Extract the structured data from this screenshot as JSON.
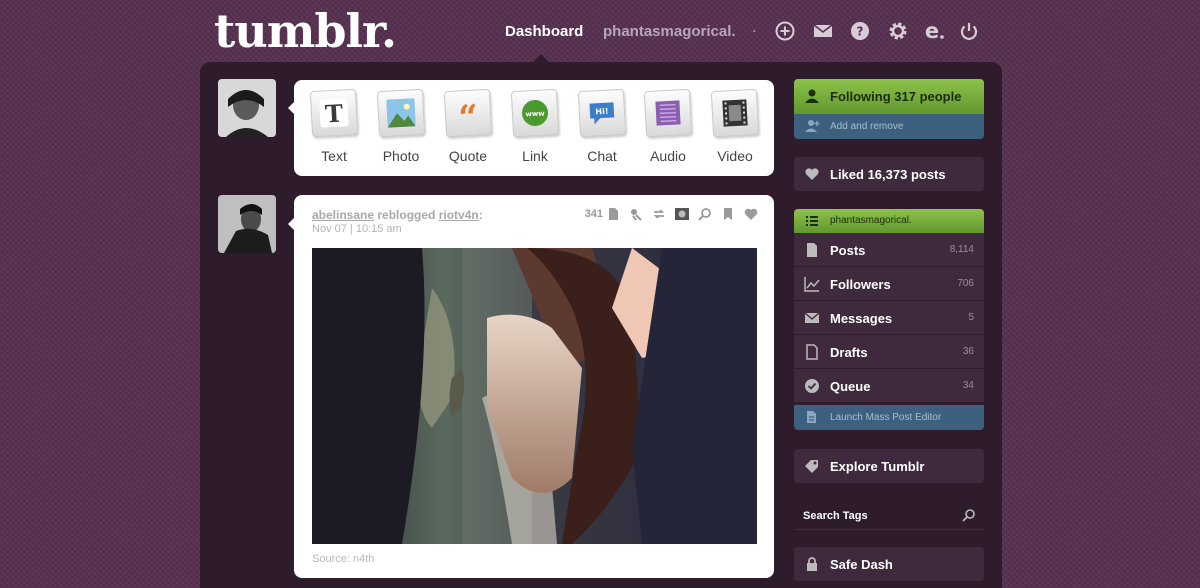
{
  "header": {
    "logo": "tumblr.",
    "nav_dashboard": "Dashboard",
    "nav_user": "phantasmagorical.",
    "nav_dot": ".",
    "icons": [
      "new-post-icon",
      "mail-icon",
      "help-icon",
      "settings-icon",
      "extension-icon",
      "logout-icon"
    ]
  },
  "post_types": [
    {
      "label": "Text",
      "icon": "text-icon",
      "color": "#3b3b3b"
    },
    {
      "label": "Photo",
      "icon": "photo-icon",
      "color": "#4a8fc9"
    },
    {
      "label": "Quote",
      "icon": "quote-icon",
      "color": "#e07a2a"
    },
    {
      "label": "Link",
      "icon": "link-icon",
      "color": "#4a9a2e"
    },
    {
      "label": "Chat",
      "icon": "chat-icon",
      "color": "#3a7dc9"
    },
    {
      "label": "Audio",
      "icon": "audio-icon",
      "color": "#8a5fb0"
    },
    {
      "label": "Video",
      "icon": "video-icon",
      "color": "#333333"
    }
  ],
  "post": {
    "author": "abelinsane",
    "action": " reblogged ",
    "reblogged_from": "riotv4n",
    "colon": ":",
    "date": "Nov 07 | 10:15 am",
    "notes": "341",
    "source": "Source: n4th"
  },
  "sidebar": {
    "following": "Following 317 people",
    "add_remove": "Add and remove",
    "liked": "Liked 16,373 posts",
    "blog": "phantasmagorical.",
    "items": [
      {
        "label": "Posts",
        "count": "8,114",
        "icon": "posts-icon"
      },
      {
        "label": "Followers",
        "count": "706",
        "icon": "followers-icon"
      },
      {
        "label": "Messages",
        "count": "5",
        "icon": "messages-icon"
      },
      {
        "label": "Drafts",
        "count": "36",
        "icon": "drafts-icon"
      },
      {
        "label": "Queue",
        "count": "34",
        "icon": "queue-icon"
      }
    ],
    "mass_editor": "Launch Mass Post Editor",
    "explore": "Explore Tumblr",
    "search_label": "Search Tags",
    "safe_dash": "Safe Dash"
  },
  "colors": {
    "background": "#56304f",
    "panel": "#2e1c2c",
    "green": "#7db340",
    "blue": "#3c607e"
  }
}
